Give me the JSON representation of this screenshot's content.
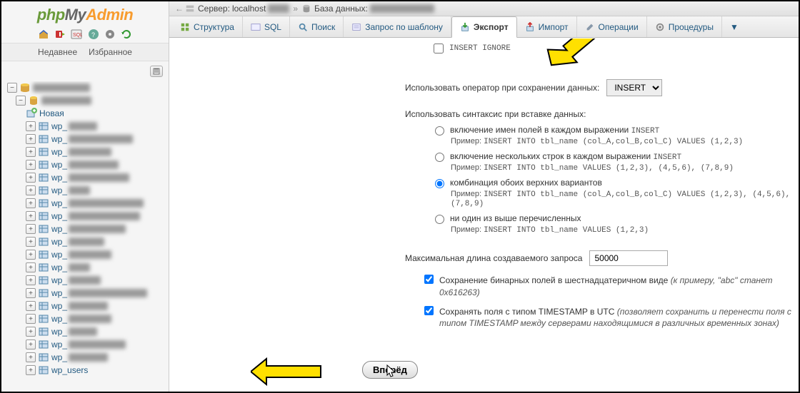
{
  "logo": {
    "p1": "php",
    "p2": "My",
    "p3": "Admin"
  },
  "sidebar": {
    "recent": "Недавнее",
    "favorite": "Избранное",
    "new_label": "Новая",
    "tables": [
      {
        "prefix": "wp_",
        "blur_w": 40
      },
      {
        "prefix": "wp_",
        "blur_w": 90
      },
      {
        "prefix": "wp_",
        "blur_w": 60
      },
      {
        "prefix": "wp_",
        "blur_w": 70
      },
      {
        "prefix": "wp_",
        "blur_w": 85
      },
      {
        "prefix": "wp_",
        "blur_w": 30
      },
      {
        "prefix": "wp_",
        "blur_w": 105
      },
      {
        "prefix": "wp_",
        "blur_w": 100
      },
      {
        "prefix": "wp_",
        "blur_w": 80
      },
      {
        "prefix": "wp_",
        "blur_w": 50
      },
      {
        "prefix": "wp_",
        "blur_w": 60
      },
      {
        "prefix": "wp_",
        "blur_w": 30
      },
      {
        "prefix": "wp_",
        "blur_w": 45
      },
      {
        "prefix": "wp_",
        "blur_w": 110
      },
      {
        "prefix": "wp_",
        "blur_w": 55
      },
      {
        "prefix": "wp_",
        "blur_w": 60
      },
      {
        "prefix": "wp_",
        "blur_w": 40
      },
      {
        "prefix": "wp_",
        "blur_w": 80
      },
      {
        "prefix": "wp_",
        "blur_w": 55
      },
      {
        "prefix": "wp_users",
        "blur_w": 0
      }
    ]
  },
  "breadcrumb": {
    "server_label": "Сервер:",
    "server_value": "localhost",
    "db_label": "База данных:"
  },
  "tabs": {
    "structure": "Структура",
    "sql": "SQL",
    "search": "Поиск",
    "query": "Запрос по шаблону",
    "export": "Экспорт",
    "import": "Импорт",
    "operations": "Операции",
    "routines": "Процедуры"
  },
  "form": {
    "insert_ignore": "INSERT IGNORE",
    "use_operator": "Использовать оператор при сохранении данных:",
    "operator_value": "INSERT",
    "use_syntax": "Использовать синтаксис при вставке данных:",
    "r1_label": "включение имен полей в каждом выражении",
    "r1_code": "INSERT",
    "r1_ex_prefix": "Пример:",
    "r1_ex": "INSERT INTO tbl_name (col_A,col_B,col_C) VALUES (1,2,3)",
    "r2_label": "включение нескольких строк в каждом выражении",
    "r2_code": "INSERT",
    "r2_ex_prefix": "Пример:",
    "r2_ex": "INSERT INTO tbl_name VALUES (1,2,3), (4,5,6), (7,8,9)",
    "r3_label": "комбинация обоих верхних вариантов",
    "r3_ex_prefix": "Пример:",
    "r3_ex": "INSERT INTO tbl_name (col_A,col_B,col_C) VALUES (1,2,3), (4,5,6), (7,8,9)",
    "r4_label": "ни один из выше перечисленных",
    "r4_ex_prefix": "Пример:",
    "r4_ex": "INSERT INTO tbl_name VALUES (1,2,3)",
    "maxlen_label": "Максимальная длина создаваемого запроса",
    "maxlen_value": "50000",
    "hex_label": "Сохранение бинарных полей в шестнадцатеричном виде",
    "hex_hint": "(к примеру, \"abc\" станет 0x616263)",
    "utc_label": "Сохранять поля с типом TIMESTAMP в UTC",
    "utc_hint": "(позволяет сохранить и перенести поля с типом TIMESTAMP между серверами находящимися в различных временных зонах)",
    "go": "Вперёд"
  }
}
